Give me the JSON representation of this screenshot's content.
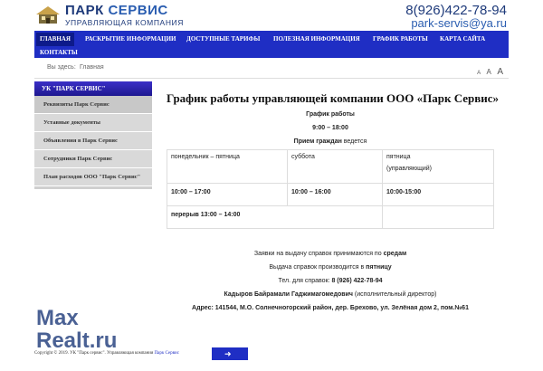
{
  "header": {
    "logo_title_a": "ПАРК ",
    "logo_title_b": "СЕРВИС",
    "logo_subtitle": "УПРАВЛЯЮЩАЯ КОМПАНИЯ",
    "phone": "8(926)422-78-94",
    "email": "park-servis@ya.ru"
  },
  "nav": {
    "items": [
      {
        "label": "ГЛАВНАЯ",
        "active": true
      },
      {
        "label": "РАСКРЫТИЕ ИНФОРМАЦИИ"
      },
      {
        "label": "ДОСТУПНЫЕ ТАРИФЫ"
      },
      {
        "label": "ПОЛЕЗНАЯ ИНФОРМАЦИЯ"
      },
      {
        "label": "ГРАФИК РАБОТЫ"
      },
      {
        "label": "КАРТА САЙТА"
      },
      {
        "label": "КОНТАКТЫ"
      }
    ]
  },
  "breadcrumb": {
    "here_label": "Вы здесь:",
    "home": "Главная"
  },
  "fontsize": {
    "small": "A",
    "medium": "A",
    "large": "A"
  },
  "sidebar": {
    "title": "УК \"ПАРК СЕРВИС\"",
    "items": [
      "Реквизиты Парк Сервис",
      "Уставные документы",
      "Объявления в Парк Сервис",
      "Сотрудники Парк Сервис",
      "План расходов ООО \"Парк Сервис\""
    ]
  },
  "content": {
    "title": "График работы управляющей компании ООО «Парк Сервис»",
    "subtitle": "График работы",
    "hours": "9:00 – 18:00",
    "reception_bold": "Прием граждан",
    "reception_rest": " ведется",
    "table": {
      "headers": [
        "понедельник – пятница",
        "суббота",
        "пятница"
      ],
      "header_note": "(управляющий)",
      "times": [
        "10:00 – 17:00",
        "10:00 – 16:00",
        "10:00-15:00"
      ],
      "break": "перерыв  13:00 – 14:00"
    },
    "lines": {
      "l1_pre": "Заявки на выдачу справок принимаются по ",
      "l1_bold": "средам",
      "l2_pre": "Выдача справок производится в ",
      "l2_bold": "пятницу",
      "l3_pre": "Тел. для справок: ",
      "l3_bold": "8 (926) 422-78-94",
      "l4_bold": "Кадыров Байрамали Гаджимагомедович",
      "l4_rest": " (исполнительный директор)",
      "l5": "Адрес: 141544, М.О. Солнечногорский район, дер. Брехово, ул. Зелёная дом 2, пом.№61"
    }
  },
  "footer": {
    "copyright": "Copyright © 2019. УК \"Парк сервис\". Управляющая компания ",
    "link": "Парк Сервис"
  },
  "watermark": {
    "line1": "Max",
    "line2": "Realt.ru"
  },
  "colors": {
    "nav_bg": "#1f2ec4",
    "brand": "#1e3a7a"
  }
}
